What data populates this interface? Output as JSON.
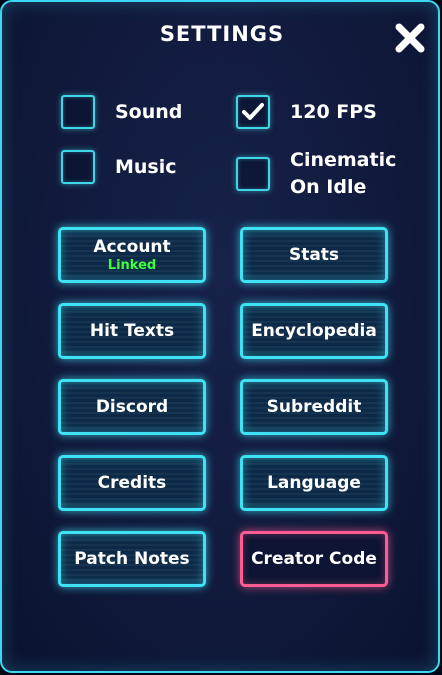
{
  "header": {
    "title": "SETTINGS",
    "close_icon": "close-x-icon"
  },
  "checkboxes": [
    {
      "label": "Sound",
      "checked": false
    },
    {
      "label": "120 FPS",
      "checked": true
    },
    {
      "label": "Music",
      "checked": false
    },
    {
      "label_line1": "Cinematic",
      "label_line2": "On Idle",
      "checked": false
    }
  ],
  "buttons": {
    "account": {
      "label": "Account",
      "status": "Linked"
    },
    "stats": {
      "label": "Stats"
    },
    "hit_texts": {
      "label": "Hit Texts"
    },
    "encyclopedia": {
      "label": "Encyclopedia"
    },
    "discord": {
      "label": "Discord"
    },
    "subreddit": {
      "label": "Subreddit"
    },
    "credits": {
      "label": "Credits"
    },
    "language": {
      "label": "Language"
    },
    "patch_notes": {
      "label": "Patch Notes"
    },
    "creator_code": {
      "label": "Creator Code"
    }
  },
  "colors": {
    "panel_border": "#3ad8f2",
    "button_border": "#3fe2f5",
    "creator_code_border": "#ff5d92",
    "linked_status": "#3cff3c",
    "text": "#ffffff"
  }
}
